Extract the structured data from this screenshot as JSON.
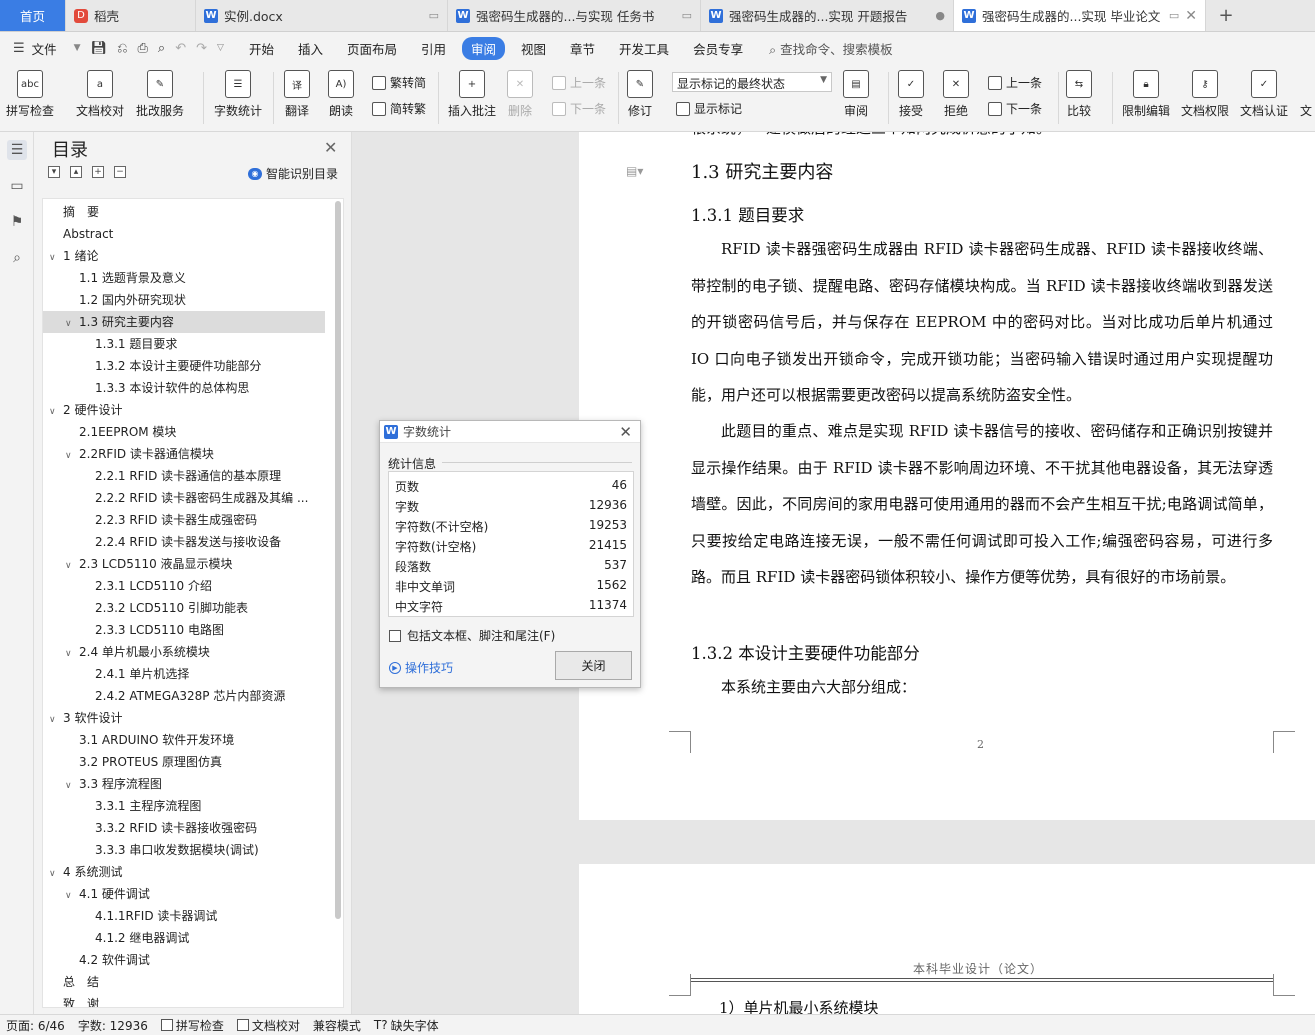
{
  "tabs": {
    "home": "首页",
    "items": [
      {
        "label": "稻壳",
        "icon": "daoke-icon"
      },
      {
        "label": "实例.docx",
        "icon": "word-doc-icon"
      },
      {
        "label": "强密码生成器的...与实现 任务书",
        "icon": "word-doc-icon"
      },
      {
        "label": "强密码生成器的...实现 开题报告",
        "icon": "word-doc-icon"
      },
      {
        "label": "强密码生成器的...实现 毕业论文",
        "icon": "word-doc-icon"
      }
    ],
    "add": "+"
  },
  "menu": {
    "file": "文件",
    "items": [
      "开始",
      "插入",
      "页面布局",
      "引用",
      "审阅",
      "视图",
      "章节",
      "开发工具",
      "会员专享"
    ],
    "active": "审阅",
    "search": "查找命令、搜索模板"
  },
  "ribbon": {
    "spell": "拼写检查",
    "proof": "文档校对",
    "annotate_service": "批改服务",
    "word_count": "字数统计",
    "translate": "翻译",
    "read_aloud": "朗读",
    "trad": "繁转简",
    "simp": "简转繁",
    "insert_comment": "插入批注",
    "delete": "删除",
    "prev": "上一条",
    "next": "下一条",
    "revise": "修订",
    "markup_state": "显示标记的最终状态",
    "show_markup": "显示标记",
    "review": "审阅",
    "accept": "接受",
    "reject": "拒绝",
    "prev2": "上一条",
    "next2": "下一条",
    "compare": "比较",
    "restrict": "限制编辑",
    "doc_perm": "文档权限",
    "doc_cert": "文档认证",
    "more": "文"
  },
  "toc": {
    "title": "目录",
    "ai": "智能识别目录",
    "items": [
      {
        "label": "摘　要",
        "level": 0,
        "chev": false
      },
      {
        "label": "Abstract",
        "level": 0,
        "chev": false
      },
      {
        "label": "1 绪论",
        "level": 0,
        "chev": true
      },
      {
        "label": "1.1 选题背景及意义",
        "level": 1,
        "chev": false
      },
      {
        "label": "1.2 国内外研究现状",
        "level": 1,
        "chev": false
      },
      {
        "label": "1.3 研究主要内容",
        "level": 1,
        "chev": true,
        "selected": true
      },
      {
        "label": "1.3.1 题目要求",
        "level": 2,
        "chev": false
      },
      {
        "label": "1.3.2 本设计主要硬件功能部分",
        "level": 2,
        "chev": false
      },
      {
        "label": "1.3.3 本设计软件的总体构思",
        "level": 2,
        "chev": false
      },
      {
        "label": "2 硬件设计",
        "level": 0,
        "chev": true
      },
      {
        "label": "2.1EEPROM 模块",
        "level": 1,
        "chev": false
      },
      {
        "label": "2.2RFID 读卡器通信模块",
        "level": 1,
        "chev": true
      },
      {
        "label": "2.2.1 RFID 读卡器通信的基本原理",
        "level": 2,
        "chev": false
      },
      {
        "label": "2.2.2 RFID 读卡器密码生成器及其编 ...",
        "level": 2,
        "chev": false
      },
      {
        "label": "2.2.3 RFID 读卡器生成强密码",
        "level": 2,
        "chev": false
      },
      {
        "label": "2.2.4 RFID 读卡器发送与接收设备",
        "level": 2,
        "chev": false
      },
      {
        "label": "2.3 LCD5110 液晶显示模块",
        "level": 1,
        "chev": true
      },
      {
        "label": "2.3.1 LCD5110 介绍",
        "level": 2,
        "chev": false
      },
      {
        "label": "2.3.2 LCD5110 引脚功能表",
        "level": 2,
        "chev": false
      },
      {
        "label": "2.3.3 LCD5110 电路图",
        "level": 2,
        "chev": false
      },
      {
        "label": "2.4  单片机最小系统模块",
        "level": 1,
        "chev": true
      },
      {
        "label": "2.4.1 单片机选择",
        "level": 2,
        "chev": false
      },
      {
        "label": "2.4.2 ATMEGA328P 芯片内部资源",
        "level": 2,
        "chev": false
      },
      {
        "label": "3 软件设计",
        "level": 0,
        "chev": true
      },
      {
        "label": "3.1 ARDUINO 软件开发环境",
        "level": 1,
        "chev": false
      },
      {
        "label": "3.2 PROTEUS 原理图仿真",
        "level": 1,
        "chev": false
      },
      {
        "label": "3.3  程序流程图",
        "level": 1,
        "chev": true
      },
      {
        "label": "3.3.1  主程序流程图",
        "level": 2,
        "chev": false
      },
      {
        "label": "3.3.2 RFID 读卡器接收强密码",
        "level": 2,
        "chev": false
      },
      {
        "label": "3.3.3  串口收发数据模块(调试)",
        "level": 2,
        "chev": false
      },
      {
        "label": "4 系统测试",
        "level": 0,
        "chev": true
      },
      {
        "label": "4.1  硬件调试",
        "level": 1,
        "chev": true
      },
      {
        "label": "4.1.1RFID 读卡器调试",
        "level": 2,
        "chev": false
      },
      {
        "label": "4.1.2 继电器调试",
        "level": 2,
        "chev": false
      },
      {
        "label": "4.2 软件调试",
        "level": 1,
        "chev": false
      },
      {
        "label": "总　结",
        "level": 0,
        "chev": false
      },
      {
        "label": "致　谢",
        "level": 0,
        "chev": false
      }
    ]
  },
  "doc": {
    "top_cut": "根系统，一建模做后的经过三个知两究成价意的了知。",
    "h_13": "1.3 研究主要内容",
    "h_131": "1.3.1 题目要求",
    "p1": "RFID 读卡器强密码生成器由 RFID 读卡器密码生成器、RFID 读卡器接收终端、带控制的电子锁、提醒电路、密码存储模块构成。当 RFID 读卡器接收终端收到器发送的开锁密码信号后，并与保存在 EEPROM 中的密码对比。当对比成功后单片机通过 IO 口向电子锁发出开锁命令，完成开锁功能；当密码输入错误时通过用户实现提醒功能，用户还可以根据需要更改密码以提高系统防盗安全性。",
    "p2": "此题目的重点、难点是实现 RFID 读卡器信号的接收、密码储存和正确识别按键并显示操作结果。由于 RFID 读卡器不影响周边环境、不干扰其他电器设备，其无法穿透墙壁。因此，不同房间的家用电器可使用通用的器而不会产生相互干扰;电路调试简单，只要按给定电路连接无误，一般不需任何调试即可投入工作;编强密码容易，可进行多路。而且 RFID 读卡器密码锁体积较小、操作方便等优势，具有很好的市场前景。",
    "h_132": "1.3.2 本设计主要硬件功能部分",
    "p3": "本系统主要由六大部分组成：",
    "page_num": "2",
    "header2": "本科毕业设计（论文）",
    "bottom_cut": "1）单片机最小系统模块"
  },
  "dialog": {
    "title": "字数统计",
    "group": "统计信息",
    "rows": [
      {
        "k": "页数",
        "v": "46"
      },
      {
        "k": "字数",
        "v": "12936"
      },
      {
        "k": "字符数(不计空格)",
        "v": "19253"
      },
      {
        "k": "字符数(计空格)",
        "v": "21415"
      },
      {
        "k": "段落数",
        "v": "537"
      },
      {
        "k": "非中文单词",
        "v": "1562"
      },
      {
        "k": "中文字符",
        "v": "11374"
      }
    ],
    "include": "包括文本框、脚注和尾注(F)",
    "tips": "操作技巧",
    "close": "关闭"
  },
  "status": {
    "page": "页面: 6/46",
    "words": "字数: 12936",
    "spell": "拼写检查",
    "proof": "文档校对",
    "compat": "兼容模式",
    "font_missing": "缺失字体"
  },
  "colors": {
    "accent": "#3a7de4",
    "link": "#2f6fd9"
  }
}
